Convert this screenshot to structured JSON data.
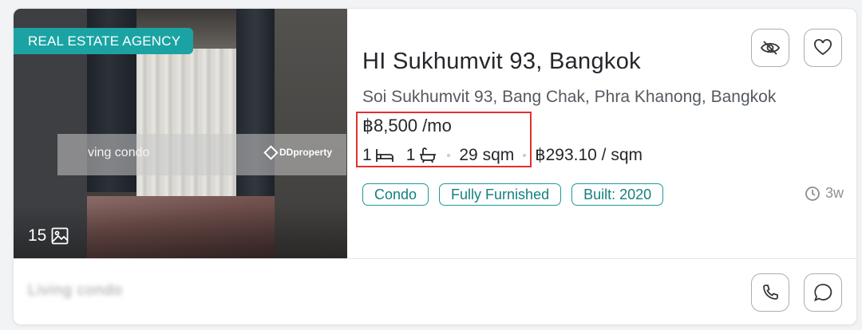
{
  "listing": {
    "badge": "REAL ESTATE AGENCY",
    "photo_count": "15",
    "watermark_left": "ving condo",
    "watermark_right": "DDproperty",
    "title": "HI Sukhumvit 93, Bangkok",
    "address": "Soi Sukhumvit 93, Bang Chak, Phra Khanong, Bangkok",
    "price": "฿8,500 /mo",
    "bedrooms": "1",
    "bathrooms": "1",
    "area": "29 sqm",
    "price_per_sqm": "฿293.10 / sqm",
    "tags": [
      "Condo",
      "Fully Furnished",
      "Built: 2020"
    ],
    "posted_ago": "3w"
  },
  "agent": {
    "name": "Living condo"
  },
  "icons": {
    "hide": "eye-off-icon",
    "favorite": "heart-icon",
    "call": "phone-icon",
    "chat": "chat-bubble-icon",
    "gallery": "image-icon",
    "bed": "bed-icon",
    "bath": "bathtub-icon",
    "time": "clock-icon"
  },
  "colors": {
    "accent": "#1ba3a3",
    "highlight": "#e3302c",
    "tag_text": "#13807f"
  }
}
